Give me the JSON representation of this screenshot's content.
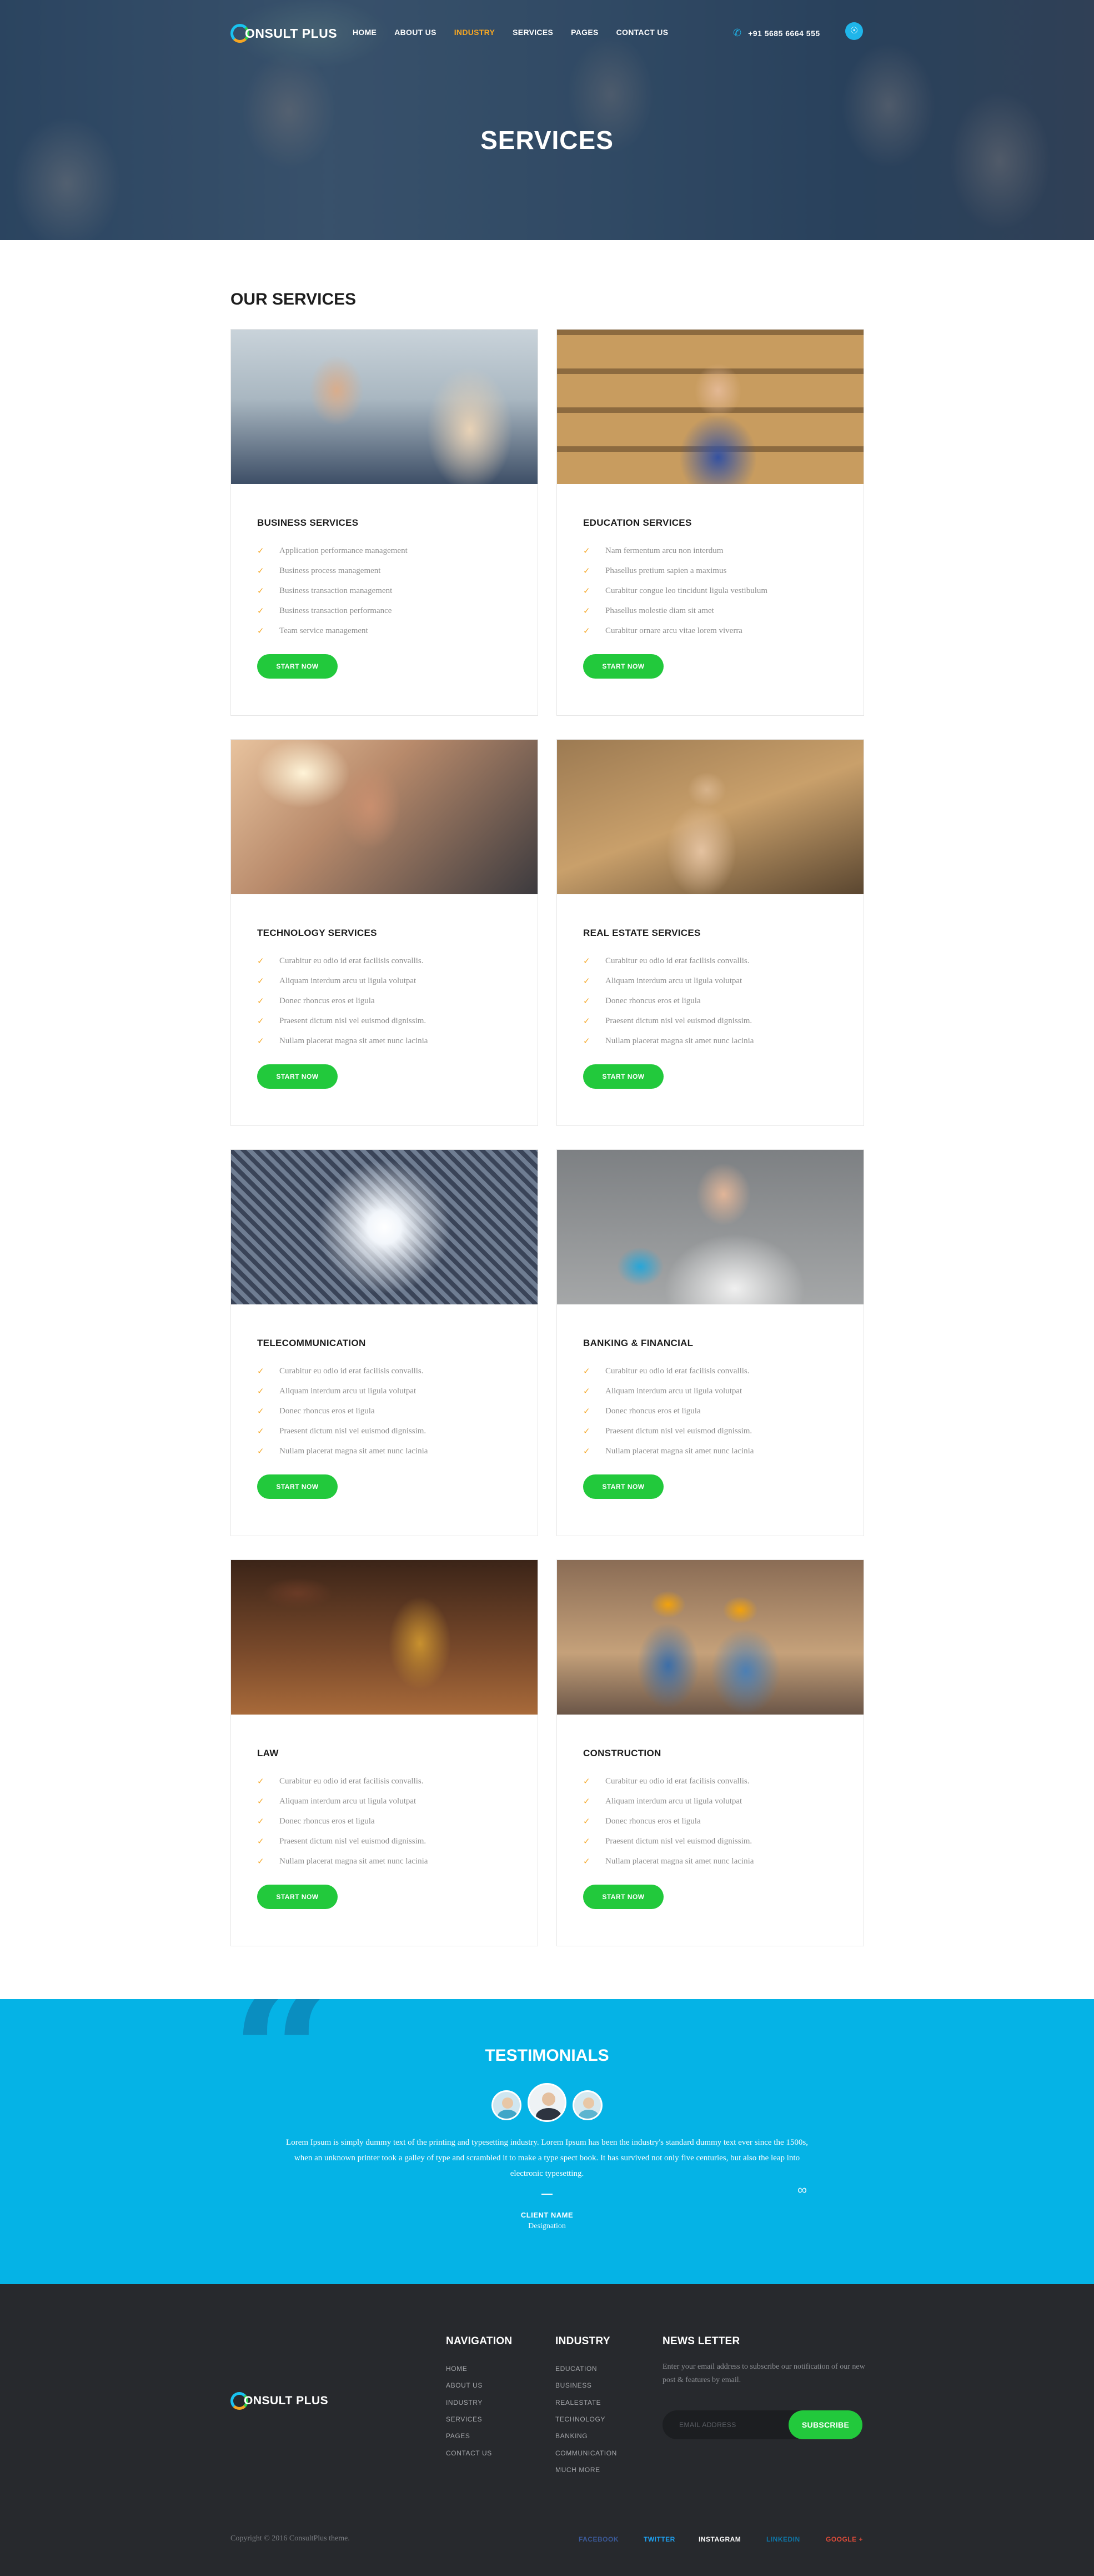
{
  "header": {
    "logo_text": "ONSULT PLUS",
    "menu": [
      "HOME",
      "ABOUT US",
      "INDUSTRY",
      "SERVICES",
      "PAGES",
      "CONTACT US"
    ],
    "active_menu": "INDUSTRY",
    "phone": "+91 5685 6664 555",
    "page_title": "SERVICES"
  },
  "services": {
    "title": "OUR SERVICES",
    "button_label": "START NOW",
    "cards": [
      {
        "title": "BUSINESS SERVICES",
        "items": [
          "Application performance management",
          "Business process management",
          "Business transaction management",
          "Business transaction performance",
          "Team service management"
        ]
      },
      {
        "title": "EDUCATION SERVICES",
        "items": [
          "Nam fermentum arcu non interdum",
          "Phasellus pretium sapien a maximus",
          "Curabitur congue leo tincidunt ligula vestibulum",
          "Phasellus molestie diam sit amet",
          "Curabitur ornare arcu vitae lorem viverra"
        ]
      },
      {
        "title": "TECHNOLOGY SERVICES",
        "items": [
          "Curabitur eu odio id erat facilisis convallis.",
          "Aliquam interdum arcu ut ligula volutpat",
          "Donec rhoncus eros et ligula",
          "Praesent dictum nisl vel euismod dignissim.",
          "Nullam placerat magna sit amet nunc lacinia"
        ]
      },
      {
        "title": "REAL ESTATE SERVICES",
        "items": [
          "Curabitur eu odio id erat facilisis convallis.",
          "Aliquam interdum arcu ut ligula volutpat",
          "Donec rhoncus eros et ligula",
          "Praesent dictum nisl vel euismod dignissim.",
          "Nullam placerat magna sit amet nunc lacinia"
        ]
      },
      {
        "title": "TELECOMMUNICATION",
        "items": [
          "Curabitur eu odio id erat facilisis convallis.",
          "Aliquam interdum arcu ut ligula volutpat",
          "Donec rhoncus eros et ligula",
          "Praesent dictum nisl vel euismod dignissim.",
          "Nullam placerat magna sit amet nunc lacinia"
        ]
      },
      {
        "title": "BANKING & FINANCIAL",
        "items": [
          "Curabitur eu odio id erat facilisis convallis.",
          "Aliquam interdum arcu ut ligula volutpat",
          "Donec rhoncus eros et ligula",
          "Praesent dictum nisl vel euismod dignissim.",
          "Nullam placerat magna sit amet nunc lacinia"
        ]
      },
      {
        "title": "LAW",
        "items": [
          "Curabitur eu odio id erat facilisis convallis.",
          "Aliquam interdum arcu ut ligula volutpat",
          "Donec rhoncus eros et ligula",
          "Praesent dictum nisl vel euismod dignissim.",
          "Nullam placerat magna sit amet nunc lacinia"
        ]
      },
      {
        "title": "CONSTRUCTION",
        "items": [
          "Curabitur eu odio id erat facilisis convallis.",
          "Aliquam interdum arcu ut ligula volutpat",
          "Donec rhoncus eros et ligula",
          "Praesent dictum nisl vel euismod dignissim.",
          "Nullam placerat magna sit amet nunc lacinia"
        ]
      }
    ]
  },
  "testimonials": {
    "title": "TESTIMONIALS",
    "text": "Lorem Ipsum is simply dummy text of the printing and typesetting industry. Lorem Ipsum has been the industry's standard dummy text ever since the 1500s, when an unknown printer took a galley of type and scrambled it to make a type spect book. It has survived not only five centuries, but also the leap into electronic typesetting.",
    "client_name": "CLIENT NAME",
    "designation": "Designation"
  },
  "footer": {
    "logo_text": "ONSULT PLUS",
    "navigation": {
      "title": "NAVIGATION",
      "items": [
        "HOME",
        "ABOUT US",
        "INDUSTRY",
        "SERVICES",
        "PAGES",
        "CONTACT US"
      ]
    },
    "industry": {
      "title": "INDUSTRY",
      "items": [
        "EDUCATION",
        "BUSINESS",
        "REALESTATE",
        "TECHNOLOGY",
        "BANKING",
        "COMMUNICATION",
        "MUCH MORE"
      ]
    },
    "newsletter": {
      "title": "NEWS LETTER",
      "text": "Enter your email address to subscribe our notification of our new post & features by email.",
      "placeholder": "EMAIL ADDRESS",
      "button": "SUBSCRIBE"
    },
    "copyright": "Copyright © 2016 ConsultPlus theme.",
    "social": [
      {
        "label": "FACEBOOK",
        "color": "#3b5998"
      },
      {
        "label": "TWITTER",
        "color": "#1da1f2"
      },
      {
        "label": "INSTAGRAM",
        "color": "#ffffff"
      },
      {
        "label": "LINKEDIN",
        "color": "#0e76a8"
      },
      {
        "label": "GOOGLE +",
        "color": "#dd4b39"
      }
    ]
  },
  "colors": {
    "accent_blue": "#05b3e6",
    "accent_green": "#22c93c",
    "accent_orange": "#f5a623",
    "footer_bg": "#27292d"
  }
}
